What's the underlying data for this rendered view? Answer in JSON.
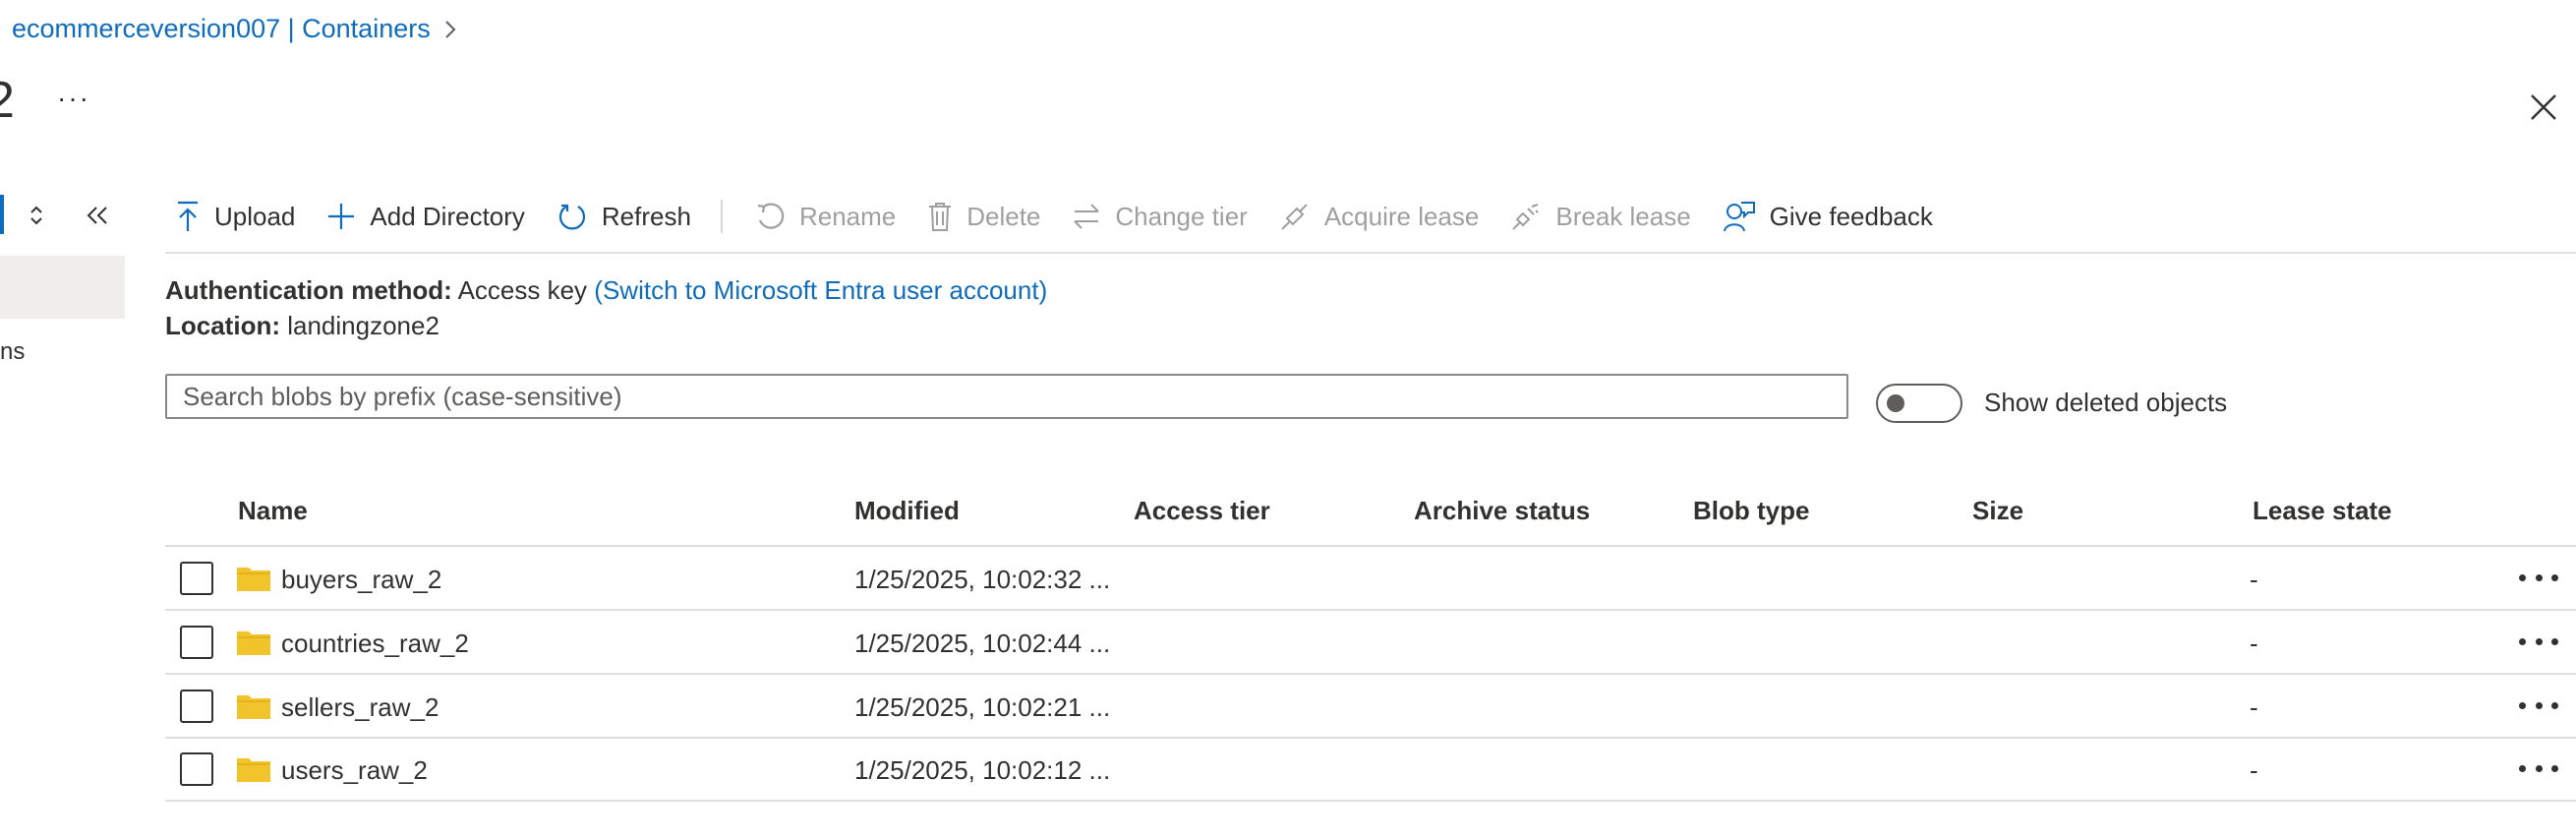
{
  "breadcrumb": {
    "text": "ecommerceversion007 | Containers"
  },
  "title": {
    "partial_glyph": "2",
    "more": "···"
  },
  "sidebar": {
    "partial_text": "ns"
  },
  "toolbar": {
    "upload": "Upload",
    "add_directory": "Add Directory",
    "refresh": "Refresh",
    "rename": "Rename",
    "delete": "Delete",
    "change_tier": "Change tier",
    "acquire_lease": "Acquire lease",
    "break_lease": "Break lease",
    "give_feedback": "Give feedback"
  },
  "auth": {
    "label": "Authentication method:",
    "value": "Access key",
    "switch_link": "(Switch to Microsoft Entra user account)"
  },
  "location": {
    "label": "Location:",
    "value": "landingzone2"
  },
  "search": {
    "placeholder": "Search blobs by prefix (case-sensitive)"
  },
  "show_deleted": {
    "label": "Show deleted objects",
    "checked": false
  },
  "table": {
    "columns": [
      "Name",
      "Modified",
      "Access tier",
      "Archive status",
      "Blob type",
      "Size",
      "Lease state"
    ],
    "rows": [
      {
        "name": "buyers_raw_2",
        "modified": "1/25/2025, 10:02:32 ...",
        "lease": "-"
      },
      {
        "name": "countries_raw_2",
        "modified": "1/25/2025, 10:02:44 ...",
        "lease": "-"
      },
      {
        "name": "sellers_raw_2",
        "modified": "1/25/2025, 10:02:21 ...",
        "lease": "-"
      },
      {
        "name": "users_raw_2",
        "modified": "1/25/2025, 10:02:12 ...",
        "lease": "-"
      }
    ]
  },
  "colors": {
    "accent": "#0f6cbd",
    "folder": "#f2c42b",
    "disabled": "#a19f9d"
  }
}
